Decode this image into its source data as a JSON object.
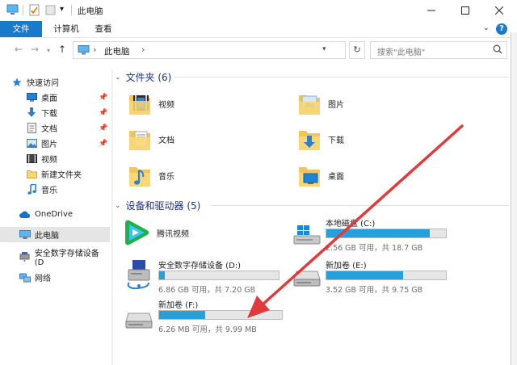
{
  "window": {
    "title": "此电脑",
    "quick_access_dropdown": "▾"
  },
  "ribbon": {
    "tabs": [
      {
        "label": "文件"
      },
      {
        "label": "计算机"
      },
      {
        "label": "查看"
      }
    ],
    "help_label": "?"
  },
  "address": {
    "crumb": "此电脑",
    "search_placeholder": "搜索\"此电脑\""
  },
  "nav": {
    "items": [
      {
        "label": "快速访问",
        "icon": "star-icon",
        "pinned": false
      },
      {
        "label": "桌面",
        "icon": "desktop-icon",
        "pinned": true
      },
      {
        "label": "下载",
        "icon": "download-icon",
        "pinned": true
      },
      {
        "label": "文档",
        "icon": "document-icon",
        "pinned": true
      },
      {
        "label": "图片",
        "icon": "picture-icon",
        "pinned": true
      },
      {
        "label": "视频",
        "icon": "video-icon",
        "pinned": false
      },
      {
        "label": "新建文件夹",
        "icon": "folder-icon",
        "pinned": false
      },
      {
        "label": "音乐",
        "icon": "music-icon",
        "pinned": false
      },
      {
        "label": "OneDrive",
        "icon": "cloud-icon",
        "pinned": false
      },
      {
        "label": "此电脑",
        "icon": "computer-icon",
        "pinned": false
      },
      {
        "label": "安全数字存储设备 (D",
        "icon": "sd-card-icon",
        "pinned": false
      },
      {
        "label": "网络",
        "icon": "network-icon",
        "pinned": false
      }
    ]
  },
  "folders": {
    "header": "文件夹 (6)",
    "items": [
      {
        "label": "视频",
        "icon": "video-folder-icon"
      },
      {
        "label": "图片",
        "icon": "picture-folder-icon"
      },
      {
        "label": "文档",
        "icon": "document-folder-icon"
      },
      {
        "label": "下载",
        "icon": "download-folder-icon"
      },
      {
        "label": "音乐",
        "icon": "music-folder-icon"
      },
      {
        "label": "桌面",
        "icon": "desktop-folder-icon"
      }
    ]
  },
  "devices": {
    "header": "设备和驱动器 (5)",
    "items": [
      {
        "name": "腾讯视频",
        "icon": "tencent-video-icon",
        "free": "",
        "used_fraction": null
      },
      {
        "name": "本地磁盘 (C:)",
        "icon": "windows-drive-icon",
        "free": "2.56 GB 可用，共 18.7 GB",
        "used_fraction": 0.863
      },
      {
        "name": "安全数字存储设备 (D:)",
        "icon": "sd-drive-icon",
        "free": "6.86 GB 可用，共 7.20 GB",
        "used_fraction": 0.047
      },
      {
        "name": "新加卷 (E:)",
        "icon": "hard-drive-icon",
        "free": "3.52 GB 可用，共 9.75 GB",
        "used_fraction": 0.639
      },
      {
        "name": "新加卷 (F:)",
        "icon": "hard-drive-icon",
        "free": "6.26 MB 可用，共 9.99 MB",
        "used_fraction": 0.373
      }
    ]
  },
  "colors": {
    "accent": "#1979ca",
    "bar_fill": "#26a0da",
    "arrow": "#e23a3a"
  }
}
